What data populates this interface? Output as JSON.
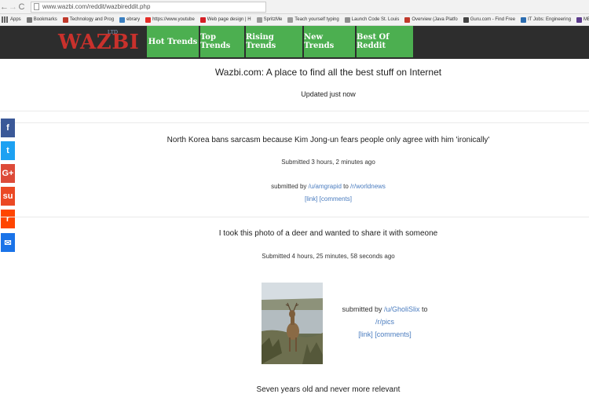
{
  "browser": {
    "back_glyph": "←",
    "forward_glyph": "→",
    "reload_glyph": "C",
    "url": "www.wazbi.com/reddit/wazbireddit.php",
    "apps_label": "Apps",
    "bookmarks": [
      {
        "label": "Bookmarks",
        "icon": "star-icon",
        "color": "#777777"
      },
      {
        "label": "Technology and Prog",
        "icon": "bookmark-icon",
        "color": "#c0392b"
      },
      {
        "label": "ebrary",
        "icon": "ebrary-icon",
        "color": "#3a7fc1"
      },
      {
        "label": "https://www.youtube",
        "icon": "youtube-icon",
        "color": "#e52d27"
      },
      {
        "label": "Web page design | H",
        "icon": "adobe-icon",
        "color": "#d41f26"
      },
      {
        "label": "SpritzMe",
        "icon": "page-icon",
        "color": "#9a9a9a"
      },
      {
        "label": "Teach yourself typing",
        "icon": "page-icon",
        "color": "#9a9a9a"
      },
      {
        "label": "Launch Code St. Louis",
        "icon": "launch-icon",
        "color": "#8e8e8e"
      },
      {
        "label": "Overview (Java Platfo",
        "icon": "oracle-icon",
        "color": "#c0392b"
      },
      {
        "label": "Guru.com - Find Free",
        "icon": "guru-icon",
        "color": "#444444"
      },
      {
        "label": "IT Jobs: Engineering",
        "icon": "itjobs-icon",
        "color": "#2b6cb0"
      },
      {
        "label": "MBA/P Vocabulary in",
        "icon": "vocab-icon",
        "color": "#5b3a8c"
      }
    ]
  },
  "site": {
    "logo": "WAZBI",
    "logo_sup": "LTD",
    "tabs": [
      {
        "label": "Hot Trends"
      },
      {
        "label": "Top Trends"
      },
      {
        "label": "Rising Trends"
      },
      {
        "label": "New Trends"
      },
      {
        "label": "Best Of Reddit"
      }
    ],
    "headline": "Wazbi.com: A place to find all the best stuff on Internet",
    "updated": "Updated just now",
    "accent": "#4caf50"
  },
  "share": [
    {
      "name": "facebook",
      "glyph": "f",
      "color": "#3b5998"
    },
    {
      "name": "twitter",
      "glyph": "t",
      "color": "#1da1f2"
    },
    {
      "name": "google-plus",
      "glyph": "G+",
      "color": "#dd4b39"
    },
    {
      "name": "stumbleupon",
      "glyph": "su",
      "color": "#eb4924"
    },
    {
      "name": "reddit",
      "glyph": "r",
      "color": "#ff4500"
    },
    {
      "name": "email",
      "glyph": "✉",
      "color": "#1a73e8"
    }
  ],
  "posts": [
    {
      "title": "North Korea bans sarcasm because Kim Jong-un fears people only agree with him 'ironically'",
      "submitted": "Submitted 3 hours, 2 minutes ago",
      "by_prefix": "submitted by ",
      "user": "/u/amgrapid",
      "to": " to ",
      "sub": "/r/worldnews",
      "link": "[link]",
      "comments": "[comments]"
    },
    {
      "title": "I took this photo of a deer and wanted to share it with someone",
      "submitted": "Submitted 4 hours, 25 minutes, 58 seconds ago",
      "by_prefix": "submitted by ",
      "user": "/u/GholiSlix",
      "to": " to",
      "sub": "/r/pics",
      "link": "[link]",
      "comments": "[comments]"
    },
    {
      "title": "Seven years old and never more relevant"
    }
  ]
}
